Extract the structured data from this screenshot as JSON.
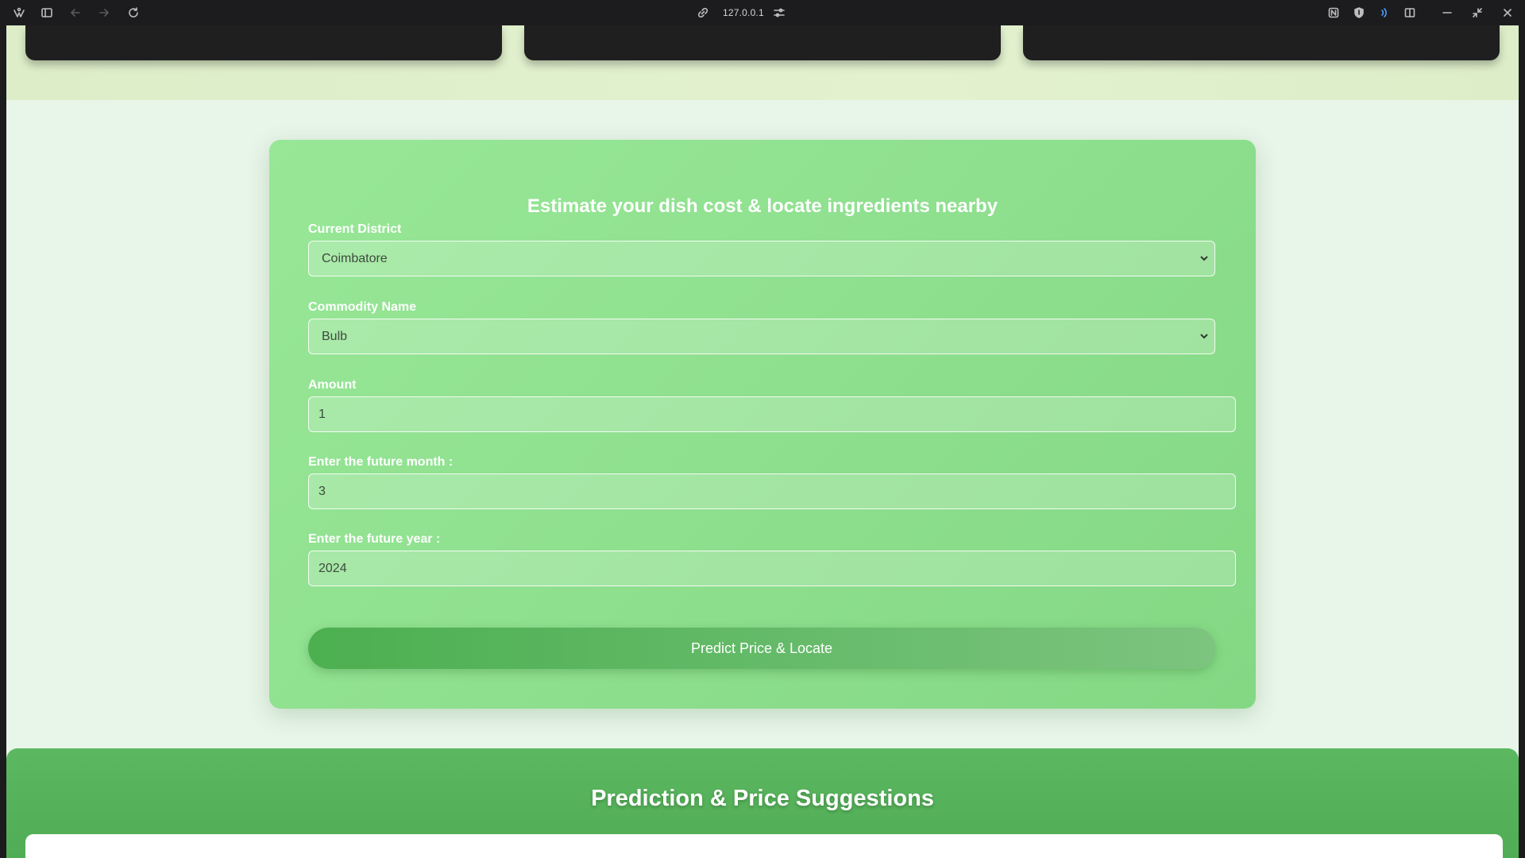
{
  "browser": {
    "url": "127.0.0.1"
  },
  "form": {
    "title": "Estimate your dish cost & locate ingredients nearby",
    "district": {
      "label": "Current District",
      "value": "Coimbatore"
    },
    "commodity": {
      "label": "Commodity Name",
      "value": "Bulb"
    },
    "amount": {
      "label": "Amount",
      "value": "1"
    },
    "month": {
      "label": "Enter the future month :",
      "value": "3"
    },
    "year": {
      "label": "Enter the future year :",
      "value": "2024"
    },
    "submit_label": "Predict Price & Locate"
  },
  "prediction": {
    "title": "Prediction & Price Suggestions"
  },
  "colors": {
    "card_green": "#8fe08f",
    "button_green": "#4caf50",
    "page_bg": "#e8f5e9",
    "section_green": "#5cb860"
  }
}
